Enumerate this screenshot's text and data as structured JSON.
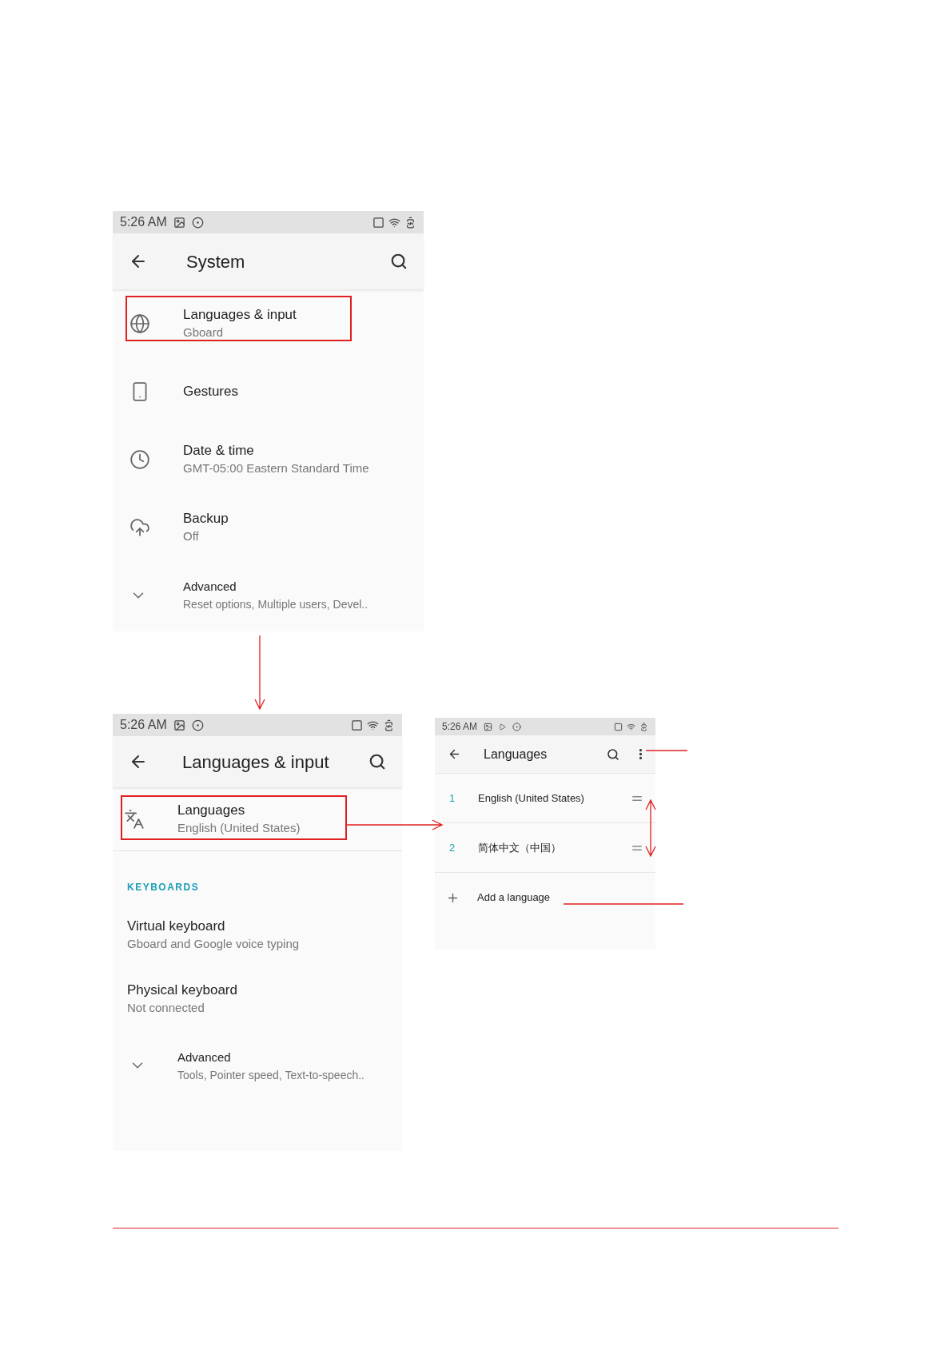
{
  "screens": [
    {
      "status_bar": {
        "time": "5:26 AM"
      },
      "title": "System",
      "items": [
        {
          "kind": "setting",
          "title": "Languages & input",
          "subtitle": "Gboard",
          "highlighted": true
        },
        {
          "kind": "setting",
          "title": "Gestures",
          "highlighted": false
        },
        {
          "kind": "setting",
          "title": "Date & time",
          "subtitle": "GMT-05:00 Eastern Standard Time",
          "highlighted": false
        },
        {
          "kind": "setting",
          "title": "Backup",
          "subtitle": "Off",
          "highlighted": false
        },
        {
          "kind": "expander",
          "title": "Advanced",
          "subtitle": "Reset options, Multiple users, Devel..",
          "highlighted": false
        }
      ]
    },
    {
      "status_bar": {
        "time": "5:26 AM"
      },
      "title": "Languages & input",
      "items": [
        {
          "kind": "setting",
          "title": "Languages",
          "subtitle": "English (United States)",
          "highlighted": true
        },
        {
          "kind": "header",
          "title": "KEYBOARDS"
        },
        {
          "kind": "plain",
          "title": "Virtual keyboard",
          "subtitle": "Gboard and Google voice typing"
        },
        {
          "kind": "plain",
          "title": "Physical keyboard",
          "subtitle": "Not connected"
        },
        {
          "kind": "expander",
          "title": "Advanced",
          "subtitle": "Tools, Pointer speed, Text-to-speech..",
          "highlighted": false
        }
      ]
    },
    {
      "status_bar": {
        "time": "5:26 AM"
      },
      "title": "Languages",
      "items": [
        {
          "kind": "language",
          "number": "1",
          "title": "English (United States)"
        },
        {
          "kind": "language",
          "number": "2",
          "title": "简体中文（中国）"
        },
        {
          "kind": "add",
          "title": "Add a language"
        }
      ]
    }
  ]
}
